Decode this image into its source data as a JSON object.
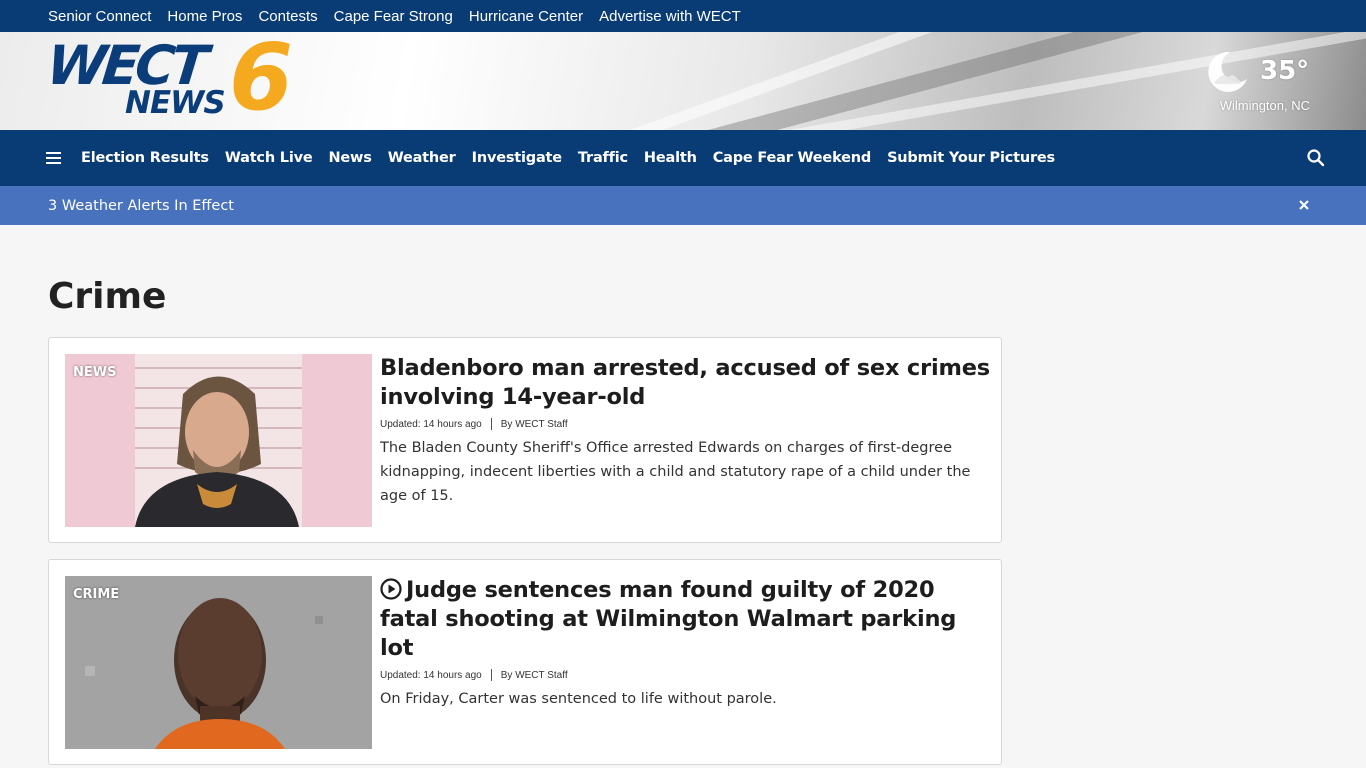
{
  "topbar": {
    "links": [
      "Senior Connect",
      "Home Pros",
      "Contests",
      "Cape Fear Strong",
      "Hurricane Center",
      "Advertise with WECT"
    ]
  },
  "logo": {
    "wect": "WECT",
    "news": "NEWS",
    "number": "6"
  },
  "weather": {
    "temperature": "35°",
    "location": "Wilmington, NC",
    "icon": "moon-icon"
  },
  "nav": {
    "items": [
      "Election Results",
      "Watch Live",
      "News",
      "Weather",
      "Investigate",
      "Traffic",
      "Health",
      "Cape Fear Weekend",
      "Submit Your Pictures"
    ]
  },
  "alert": {
    "text": "3 Weather Alerts In Effect"
  },
  "page": {
    "title": "Crime"
  },
  "articles": [
    {
      "badge": "NEWS",
      "headline": "Bladenboro man arrested, accused of sex crimes involving 14-year-old",
      "updated": "Updated: 14 hours ago",
      "byline": "By WECT Staff",
      "summary": "The Bladen County Sheriff's Office arrested Edwards on charges of first-degree kidnapping, indecent liberties with a child and statutory rape of a child under the age of 15."
    },
    {
      "badge": "CRIME",
      "headline": "Judge sentences man found guilty of 2020 fatal shooting at Wilmington Walmart parking lot",
      "updated": "Updated: 14 hours ago",
      "byline": "By WECT Staff",
      "summary": "On Friday, Carter was sentenced to life without parole."
    }
  ],
  "colors": {
    "navy": "#093b75",
    "alert_blue": "#4872bd",
    "logo_orange": "#f5a91f"
  }
}
